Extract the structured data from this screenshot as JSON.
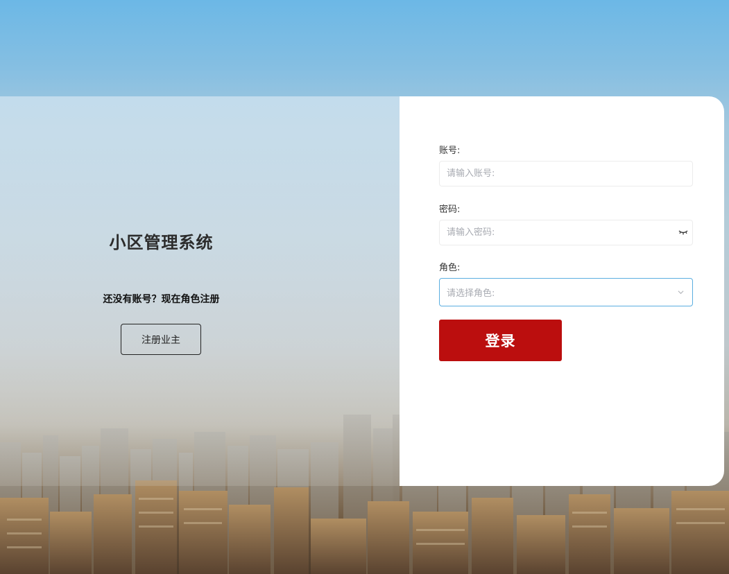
{
  "app": {
    "title": "小区管理系统"
  },
  "register": {
    "tip": "还没有账号？现在角色注册",
    "button_label": "注册业主"
  },
  "form": {
    "account_label": "账号:",
    "account_placeholder": "请输入账号:",
    "password_label": "密码:",
    "password_placeholder": "请输入密码:",
    "role_label": "角色:",
    "role_placeholder": "请选择角色:",
    "login_label": "登录"
  },
  "icons": {
    "password_toggle": "eye-closed-icon",
    "select_arrow": "chevron-down-icon"
  },
  "colors": {
    "login_button": "#bb0e0e",
    "select_border": "#5aaee0",
    "card_background": "#ffffff"
  }
}
